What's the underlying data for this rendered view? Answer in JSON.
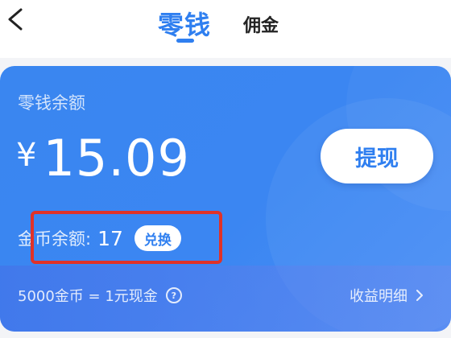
{
  "header": {
    "back_icon": "chevron-left-icon",
    "tabs": [
      {
        "label": "零钱",
        "active": true
      },
      {
        "label": "佣金",
        "active": false
      }
    ],
    "accent_color": "#2f7ff0"
  },
  "wallet": {
    "balance_label": "零钱余额",
    "currency_symbol": "¥",
    "balance_amount": "15.09",
    "withdraw_label": "提现",
    "coin_label": "金币余额:",
    "coin_value": "17",
    "exchange_label": "兑换",
    "exchange_rate": "5000金币 = 1元现金",
    "info_icon": "info-circle-icon",
    "details_label": "收益明细",
    "details_icon": "chevron-right-icon",
    "highlight_color": "#e03228"
  }
}
